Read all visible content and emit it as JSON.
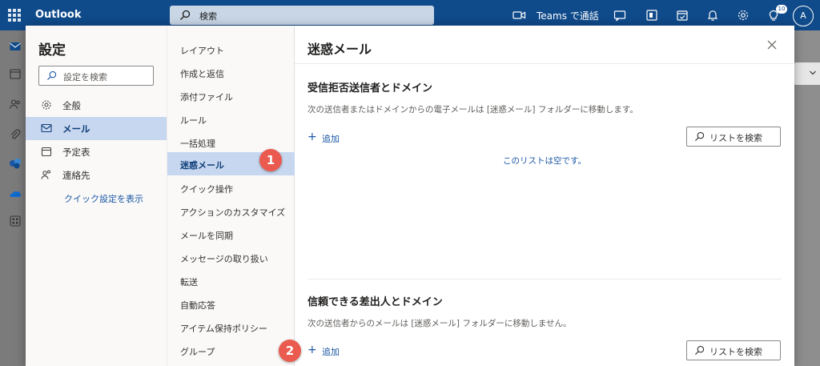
{
  "topbar": {
    "app_name": "Outlook",
    "search_placeholder": "検索",
    "teams_label": "Teams で通話",
    "notification_count": "10",
    "avatar_initial": "A"
  },
  "settings": {
    "title": "設定",
    "search_placeholder": "設定を検索",
    "categories": [
      {
        "label": "全般",
        "icon": "gear-icon"
      },
      {
        "label": "メール",
        "icon": "mail-icon"
      },
      {
        "label": "予定表",
        "icon": "calendar-icon"
      },
      {
        "label": "連絡先",
        "icon": "people-icon"
      }
    ],
    "active_category": "メール",
    "quick_settings_link": "クイック設定を表示",
    "subcategories": [
      "レイアウト",
      "作成と返信",
      "添付ファイル",
      "ルール",
      "一括処理",
      "迷惑メール",
      "クイック操作",
      "アクションのカスタマイズ",
      "メールを同期",
      "メッセージの取り扱い",
      "転送",
      "自動応答",
      "アイテム保持ポリシー",
      "グループ"
    ],
    "active_subcategory": "迷惑メール"
  },
  "pane": {
    "title": "迷惑メール",
    "blocked": {
      "title": "受信拒否送信者とドメイン",
      "description": "次の送信者またはドメインからの電子メールは [迷惑メール] フォルダーに移動します。",
      "add_label": "追加",
      "search_placeholder": "リストを検索",
      "empty_message": "このリストは空です。"
    },
    "safe": {
      "title": "信頼できる差出人とドメイン",
      "description": "次の送信者からのメールは [迷惑メール] フォルダーに移動しません。",
      "add_label": "追加",
      "search_placeholder": "リストを検索"
    }
  },
  "markers": {
    "one": "1",
    "two": "2"
  },
  "colors": {
    "topbar": "#0f4a8a",
    "accent": "#1a57a5",
    "active_bg": "#c7d7ef",
    "marker": "#ea5a4f"
  }
}
